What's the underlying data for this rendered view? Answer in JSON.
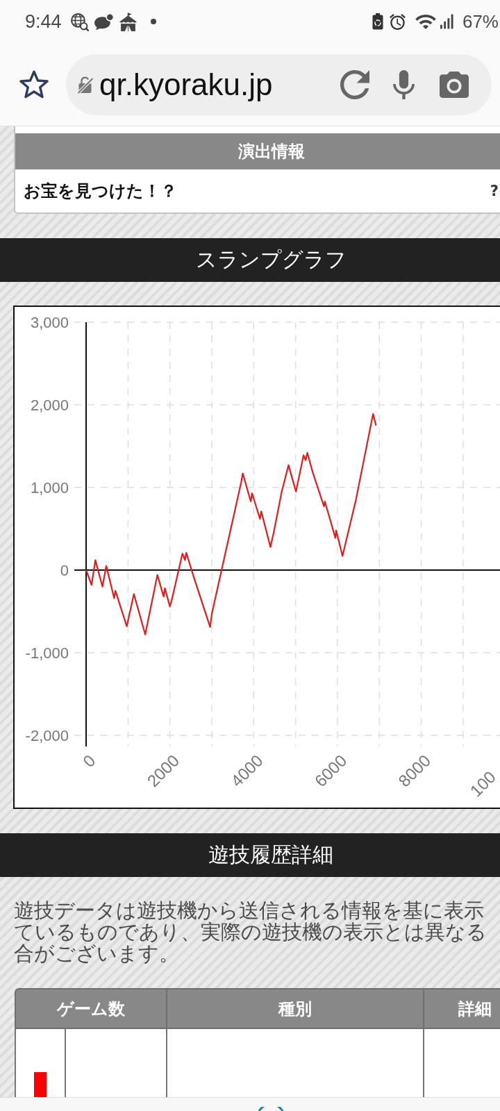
{
  "status_bar": {
    "time": "9:44",
    "battery": "67%"
  },
  "browser": {
    "url": "qr.kyoraku.jp"
  },
  "effect_info": {
    "header": "演出情報",
    "rows": [
      {
        "column_1": "お宝を見つけた！？",
        "column_2": "?"
      }
    ]
  },
  "slump_graph": {
    "title": "スランプグラフ",
    "chart_data": {
      "type": "line",
      "x": [
        0,
        130,
        220,
        390,
        480,
        670,
        700,
        970,
        1010,
        1140,
        1410,
        1700,
        1850,
        1880,
        2000,
        2040,
        2300,
        2360,
        2390,
        2580,
        2960,
        3000,
        3700,
        3740,
        3930,
        3960,
        4150,
        4180,
        4400,
        4480,
        4670,
        4830,
        5010,
        5190,
        5240,
        5280,
        5410,
        5680,
        5700,
        5950,
        5970,
        6120,
        6440,
        6850,
        6920
      ],
      "series": [
        {
          "color": "#e31b1b",
          "values": [
            0,
            -180,
            120,
            -200,
            50,
            -340,
            -250,
            -680,
            -590,
            -290,
            -780,
            -60,
            -320,
            -220,
            -440,
            -370,
            200,
            120,
            210,
            -100,
            -690,
            -530,
            1060,
            1170,
            830,
            930,
            620,
            710,
            280,
            460,
            950,
            1270,
            950,
            1390,
            1330,
            1420,
            1180,
            770,
            830,
            390,
            480,
            170,
            850,
            1890,
            1750
          ]
        }
      ],
      "xlim": [
        0,
        9880
      ],
      "ylim": [
        -2000,
        3000
      ],
      "xticks": [
        0,
        2000,
        4000,
        6000,
        8000
      ],
      "yticks": [
        {
          "value": -2000,
          "label": "-2,000"
        },
        {
          "value": -1000,
          "label": "-1,000"
        },
        {
          "value": 0,
          "label": "0"
        },
        {
          "value": 1000,
          "label": "1,000"
        },
        {
          "value": 2000,
          "label": "2,000"
        },
        {
          "value": 3000,
          "label": "3,000"
        }
      ],
      "grid": true
    },
    "cut_x_label": "100"
  },
  "play_history": {
    "title": "遊技履歴詳細",
    "notice_lines": [
      "遊技データは遊技機から送信される情報を基に表示",
      "ているものであり、実際の遊技機の表示とは異なる",
      "合がございます。"
    ],
    "table": {
      "columns": [
        "ゲーム数",
        "種別",
        "詳細"
      ]
    }
  }
}
